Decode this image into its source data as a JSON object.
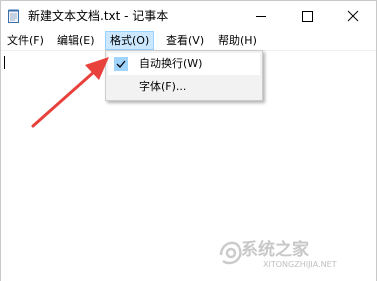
{
  "window": {
    "title": "新建文本文档.txt - 记事本"
  },
  "menubar": {
    "items": [
      {
        "label": "文件(F)"
      },
      {
        "label": "编辑(E)"
      },
      {
        "label": "格式(O)"
      },
      {
        "label": "查看(V)"
      },
      {
        "label": "帮助(H)"
      }
    ],
    "active": "格式(O)"
  },
  "format_menu": {
    "items": [
      {
        "label": "自动换行(W)",
        "checked": true
      },
      {
        "label": "字体(F)..."
      }
    ]
  },
  "editor": {
    "content": ""
  },
  "annotation": {
    "arrow_color": "#e8413b"
  },
  "watermark": {
    "text": "系统之家",
    "url": "XITONGZHIJIA.NET"
  },
  "colors": {
    "menu_highlight": "#cce8ff",
    "menu_highlight_border": "#99d1ff",
    "dropdown_bg": "#f2f2f2",
    "check_bg": "#9fd4ff"
  }
}
